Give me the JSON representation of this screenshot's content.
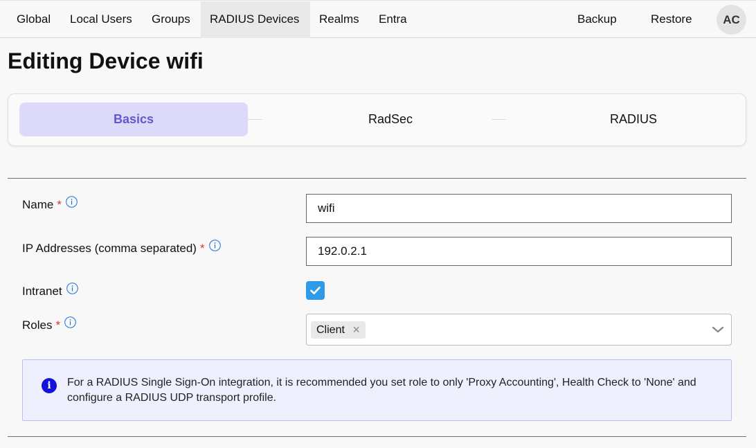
{
  "nav": {
    "items": [
      {
        "label": "Global",
        "active": false
      },
      {
        "label": "Local Users",
        "active": false
      },
      {
        "label": "Groups",
        "active": false
      },
      {
        "label": "RADIUS Devices",
        "active": true
      },
      {
        "label": "Realms",
        "active": false
      },
      {
        "label": "Entra",
        "active": false
      }
    ],
    "backup_label": "Backup",
    "restore_label": "Restore",
    "avatar_initials": "AC"
  },
  "page": {
    "title": "Editing Device wifi"
  },
  "stepper": {
    "steps": [
      {
        "label": "Basics",
        "active": true
      },
      {
        "label": "RadSec",
        "active": false
      },
      {
        "label": "RADIUS",
        "active": false
      }
    ]
  },
  "form": {
    "name": {
      "label": "Name",
      "required_mark": "*",
      "value": "wifi"
    },
    "ip_addresses": {
      "label": "IP Addresses (comma separated)",
      "required_mark": "*",
      "value": "192.0.2.1"
    },
    "intranet": {
      "label": "Intranet",
      "checked": true
    },
    "roles": {
      "label": "Roles",
      "required_mark": "*",
      "selected": [
        "Client"
      ],
      "remove_glyph": "×"
    }
  },
  "notice": {
    "icon_glyph": "i",
    "text": "For a RADIUS Single Sign-On integration, it is recommended you set role to only 'Proxy Accounting', Health Check to 'None' and configure a RADIUS UDP transport profile."
  },
  "colors": {
    "accent": "#6656d0",
    "active_step_bg": "#dcdaf8",
    "checkbox": "#2f9ae8",
    "required": "#dd3333",
    "info_icon": "#1a6fd6",
    "notice_bg": "#eef1fd",
    "notice_icon": "#1212d8"
  }
}
